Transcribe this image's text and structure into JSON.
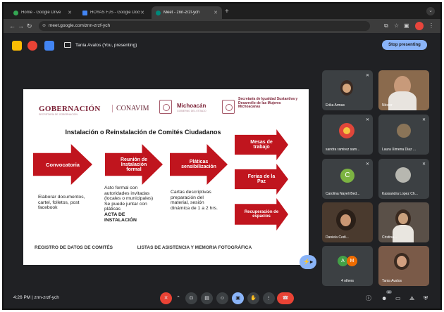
{
  "browser": {
    "tabs": [
      {
        "label": "Home - Google Drive",
        "color": "#34a853"
      },
      {
        "label": "HOYAS FJS - Google Docs",
        "color": "#4285f4"
      },
      {
        "label": "Meet - znn-zrzf-ych",
        "color": "#00897b"
      }
    ],
    "url": "meet.google.com/znn-zrzf-ych"
  },
  "meet": {
    "presenter_label": "Tania Avalos (You, presenting)",
    "stop_presenting": "Stop presenting",
    "meeting_time": "4:26 PM",
    "meeting_code": "znn-zrzf-ych",
    "participants_badge": "11"
  },
  "slide": {
    "logos": {
      "gobernacion": "GOBERNACIÓN",
      "gobernacion_sub": "SECRETARÍA DE GOBERNACIÓN",
      "conavim": "CONAVIM",
      "michoacan": "Michoacán",
      "michoacan_sub": "GOBIERNO DEL ESTADO",
      "secretaria": "Secretaría de Igualdad Sustantiva y Desarrollo de las Mujeres Michoacanas"
    },
    "title": "Instalación o Reinstalación de Comités Ciudadanos",
    "arrows": {
      "convocatoria": "Convocatoria",
      "reunion": "Reunión de Instalación formal",
      "platicas": "Pláticas sensibilización",
      "mesas": "Mesas de trabajo",
      "ferias": "Ferias de la Paz",
      "recuperacion": "Recuperación de espacios"
    },
    "texts": {
      "elaborar": "Elaborar documentos, cartel, folletos, post facebook",
      "acto": "Acto formal con autoridades invitadas (locales o municipales) Se puede juntar con pláticas",
      "acta": "ACTA DE INSTALACIÓN",
      "cartas": "Cartas descriptivas preparación del material, sesión dinámica de 1 a 2 hrs."
    },
    "footer_left": "REGISTRO DE DATOS DE COMITÉS",
    "footer_right": "LISTAS DE ASISTENCIA Y MEMORIA FOTOGRÁFICA"
  },
  "participants": [
    {
      "name": "Erika Armas"
    },
    {
      "name": "Néstor"
    },
    {
      "name": "sandra ramirez sam..."
    },
    {
      "name": "Laura Ximena Diaz ..."
    },
    {
      "name": "Carolina Nayeli Bed...",
      "initial": "C"
    },
    {
      "name": "Kassandra Lopez Ch..."
    },
    {
      "name": "Daniela Cedi..."
    },
    {
      "name": "Cristina..."
    },
    {
      "name": "4 others",
      "initials": [
        "A",
        "M"
      ]
    },
    {
      "name": "Tania Avalos"
    }
  ],
  "colors": {
    "slide_red": "#c0151e",
    "meet_blue": "#8ab4f8",
    "hangup_red": "#ea4335",
    "background": "#202124"
  }
}
